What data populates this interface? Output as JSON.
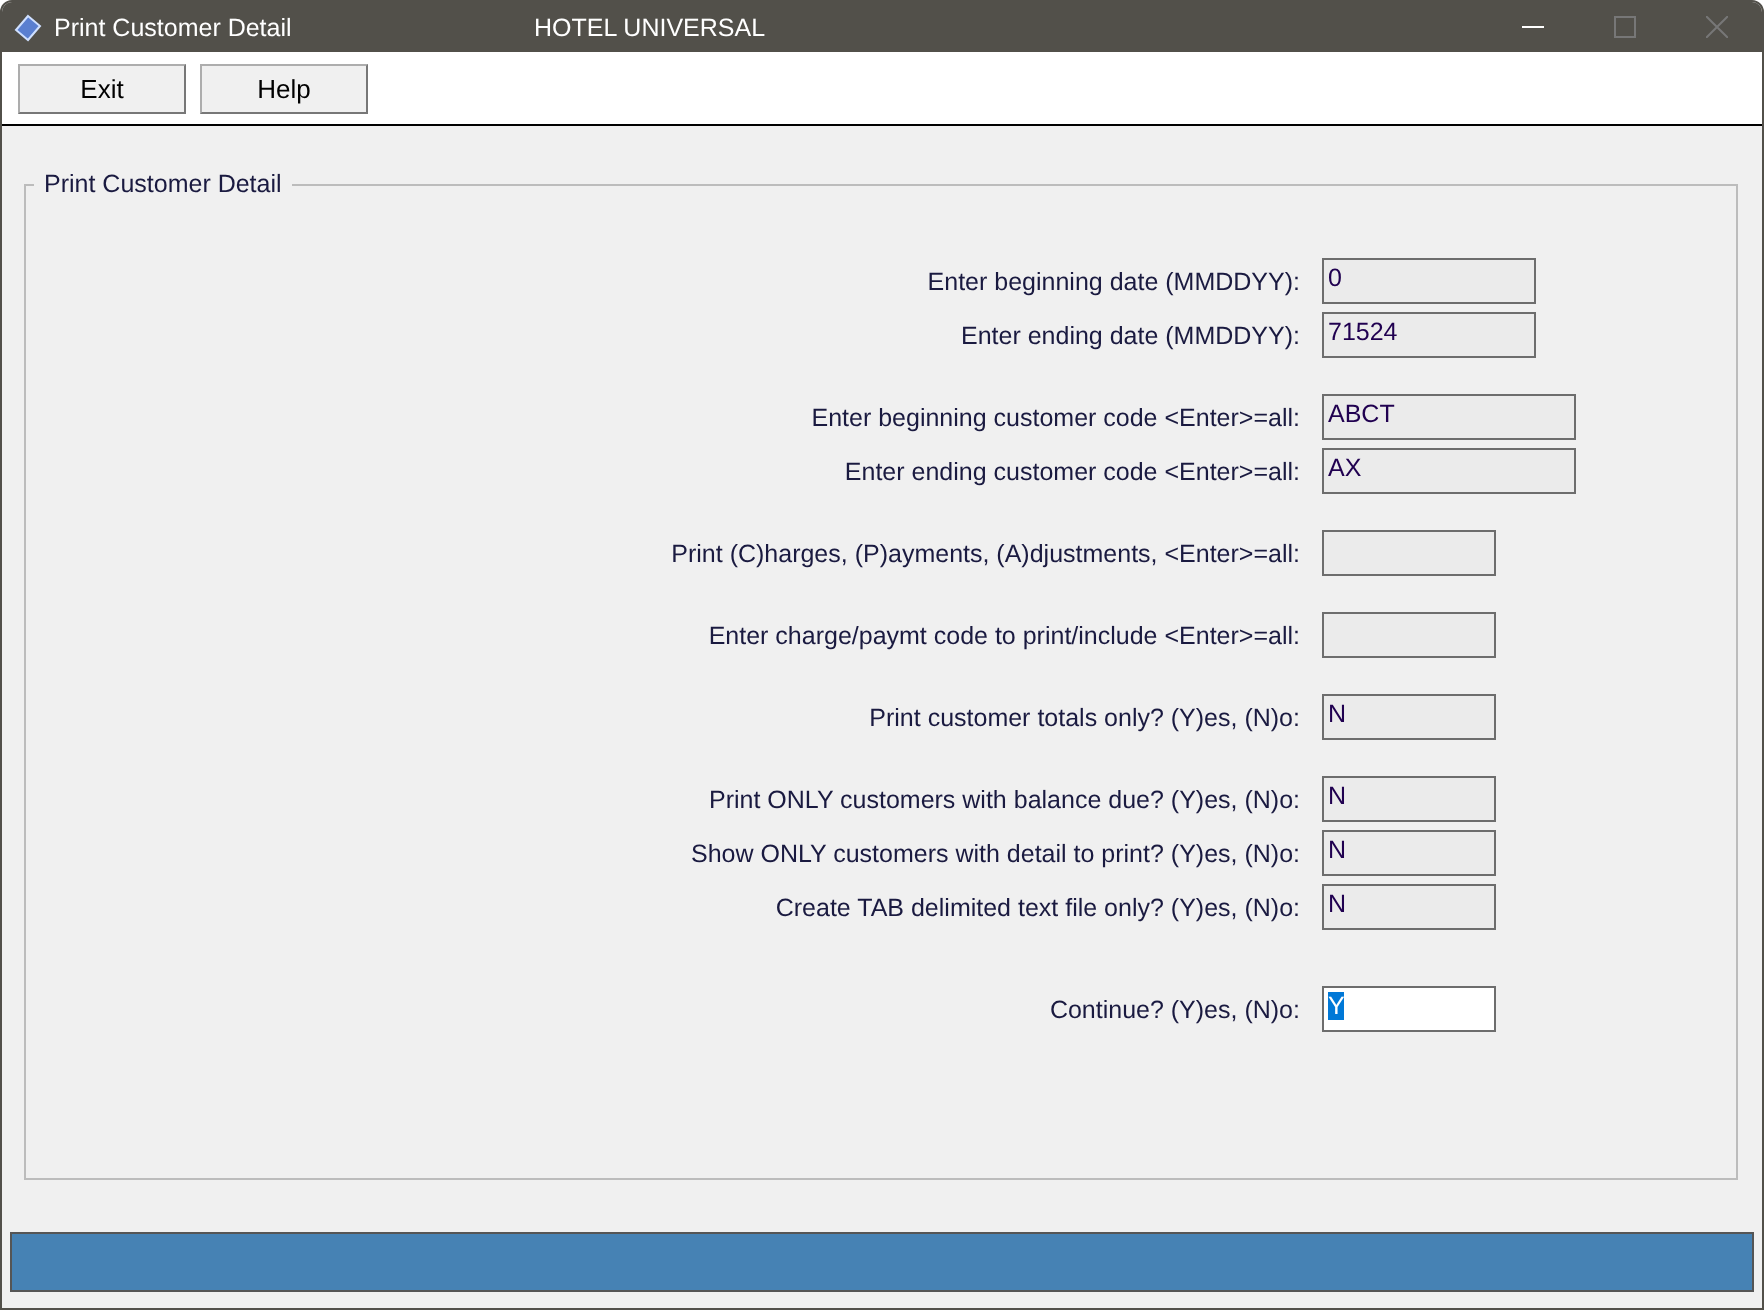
{
  "window": {
    "title": "Print Customer Detail",
    "subtitle": "HOTEL UNIVERSAL"
  },
  "toolbar": {
    "buttons": [
      "Exit",
      "Help"
    ]
  },
  "form": {
    "legend": "Print Customer Detail",
    "groups": [
      {
        "rows": [
          {
            "label": "Enter beginning date (MMDDYY):",
            "value": "0",
            "kind": "date",
            "focused": false
          },
          {
            "label": "Enter ending date (MMDDYY):",
            "value": "71524",
            "kind": "date",
            "focused": false
          }
        ]
      },
      {
        "rows": [
          {
            "label": "Enter beginning customer code <Enter>=all:",
            "value": "ABCT",
            "kind": "code",
            "focused": false
          },
          {
            "label": "Enter ending customer code <Enter>=all:",
            "value": "AX",
            "kind": "code",
            "focused": false
          }
        ]
      },
      {
        "rows": [
          {
            "label": "Print (C)harges, (P)ayments, (A)djustments, <Enter>=all:",
            "kind": "flag",
            "focused": false
          }
        ]
      },
      {
        "rows": [
          {
            "label": "Enter charge/paymt code to print/include <Enter>=all:",
            "kind": "flag",
            "focused": false
          }
        ]
      },
      {
        "rows": [
          {
            "label": "Print customer totals only? (Y)es, (N)o:",
            "value": "N",
            "kind": "flag",
            "focused": false
          }
        ]
      },
      {
        "rows": [
          {
            "label": "Print ONLY customers with balance due? (Y)es, (N)o:",
            "value": "N",
            "kind": "flag",
            "focused": false
          },
          {
            "label": "Show ONLY customers with detail to print? (Y)es, (N)o:",
            "value": "N",
            "kind": "flag",
            "focused": false
          },
          {
            "label": "Create TAB delimited text file only? (Y)es, (N)o:",
            "value": "N",
            "kind": "flag",
            "focused": false
          }
        ]
      },
      {
        "rows": [
          {
            "label": "Continue? (Y)es, (N)o:",
            "value": "Y",
            "kind": "flag",
            "focused": true
          }
        ]
      }
    ]
  }
}
